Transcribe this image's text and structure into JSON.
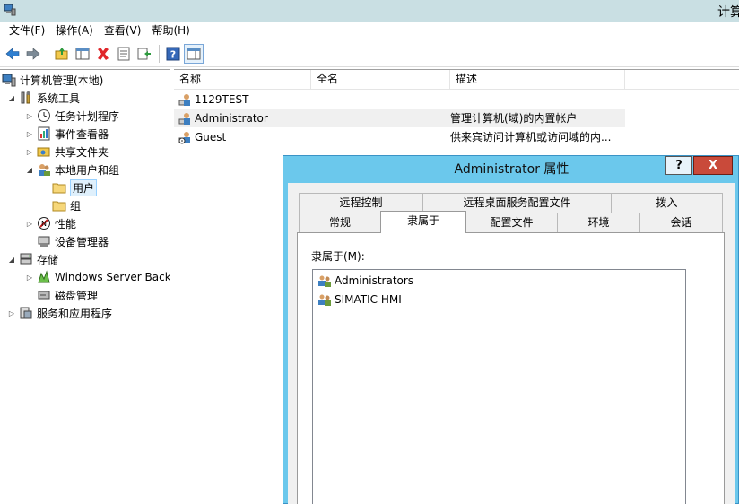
{
  "window": {
    "title": "计算"
  },
  "menu": [
    "文件(F)",
    "操作(A)",
    "查看(V)",
    "帮助(H)"
  ],
  "tree": {
    "root": "计算机管理(本地)",
    "system_tools": "系统工具",
    "task_scheduler": "任务计划程序",
    "event_viewer": "事件查看器",
    "shared_folders": "共享文件夹",
    "local_users_groups": "本地用户和组",
    "users": "用户",
    "groups": "组",
    "performance": "性能",
    "device_manager": "设备管理器",
    "storage": "存储",
    "windows_server_backup": "Windows Server Back",
    "disk_management": "磁盘管理",
    "services_apps": "服务和应用程序"
  },
  "list": {
    "columns": [
      "名称",
      "全名",
      "描述"
    ],
    "rows": [
      {
        "name": "1129TEST",
        "fullname": "",
        "desc": ""
      },
      {
        "name": "Administrator",
        "fullname": "",
        "desc": "管理计算机(域)的内置帐户"
      },
      {
        "name": "Guest",
        "fullname": "",
        "desc": "供来宾访问计算机或访问域的内..."
      }
    ]
  },
  "dialog": {
    "title": "Administrator 属性",
    "help_label": "?",
    "close_label": "X",
    "tabs_row1": [
      "远程控制",
      "远程桌面服务配置文件",
      "拨入"
    ],
    "tabs_row2": [
      "常规",
      "隶属于",
      "配置文件",
      "环境",
      "会话"
    ],
    "selected_tab": "隶属于",
    "member_label": "隶属于(M):",
    "members": [
      "Administrators",
      "SIMATIC HMI"
    ]
  }
}
